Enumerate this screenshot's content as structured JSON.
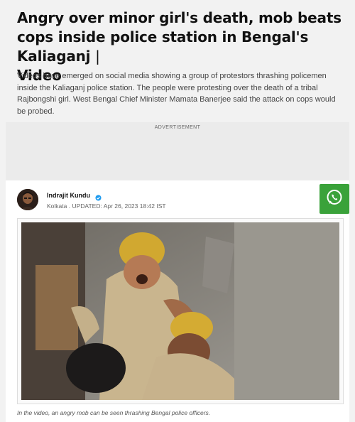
{
  "article": {
    "headline": "Angry over minor girl's death, mob beats cops inside police station in Bengal's Kaliaganj",
    "headline_suffix": "Video",
    "summary": "Videos have emerged on social media showing a group of protestors thrashing policemen inside the Kaliaganj police station. The people were protesting over the death of a tribal Rajbongshi girl. West Bengal Chief Minister Mamata Banerjee said the attack on cops would be probed."
  },
  "ad": {
    "label": "ADVERTISEMENT"
  },
  "author": {
    "name": "Indrajit Kundu",
    "location": "Kolkata",
    "updated": "UPDATED: Apr 26, 2023 18:42 IST"
  },
  "share": {
    "icon": "whatsapp-icon",
    "color": "#3aa23a"
  },
  "media": {
    "caption": "In the video, an angry mob can be seen thrashing Bengal police officers."
  }
}
